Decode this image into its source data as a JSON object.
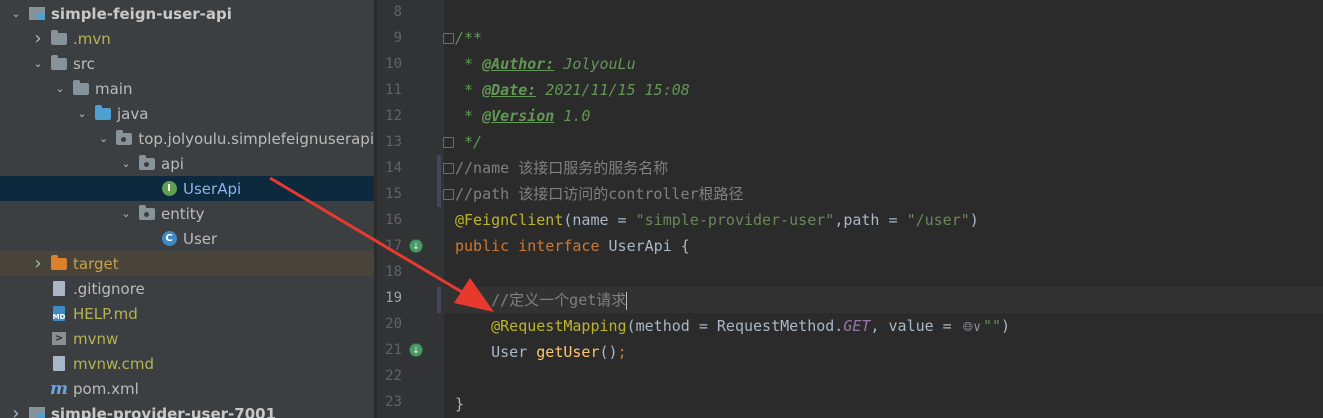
{
  "project_tree": [
    {
      "label": "simple-feign-user-api",
      "indent": 0,
      "arrow": "down",
      "icon": "module-icon",
      "style": "bold"
    },
    {
      "label": ".mvn",
      "indent": 1,
      "arrow": "right",
      "icon": "folder-icon",
      "style": "olive"
    },
    {
      "label": "src",
      "indent": 1,
      "arrow": "down",
      "icon": "folder-icon",
      "style": ""
    },
    {
      "label": "main",
      "indent": 2,
      "arrow": "down",
      "icon": "folder-icon",
      "style": ""
    },
    {
      "label": "java",
      "indent": 3,
      "arrow": "down",
      "icon": "source-folder-icon",
      "style": ""
    },
    {
      "label": "top.jolyoulu.simplefeignuserapi",
      "indent": 4,
      "arrow": "down",
      "icon": "package-icon",
      "style": ""
    },
    {
      "label": "api",
      "indent": 5,
      "arrow": "down",
      "icon": "package-icon",
      "style": ""
    },
    {
      "label": "UserApi",
      "indent": 6,
      "arrow": "",
      "icon": "interface-icon",
      "style": "link",
      "selected": true
    },
    {
      "label": "entity",
      "indent": 5,
      "arrow": "down",
      "icon": "package-icon",
      "style": ""
    },
    {
      "label": "User",
      "indent": 6,
      "arrow": "",
      "icon": "class-icon",
      "style": ""
    },
    {
      "label": "target",
      "indent": 1,
      "arrow": "right",
      "icon": "excluded-folder-icon",
      "style": "orange",
      "excluded": true
    },
    {
      "label": ".gitignore",
      "indent": 1,
      "arrow": "",
      "icon": "file-icon",
      "style": ""
    },
    {
      "label": "HELP.md",
      "indent": 1,
      "arrow": "",
      "icon": "markdown-icon",
      "style": "olive"
    },
    {
      "label": "mvnw",
      "indent": 1,
      "arrow": "",
      "icon": "terminal-icon",
      "style": "olive"
    },
    {
      "label": "mvnw.cmd",
      "indent": 1,
      "arrow": "",
      "icon": "file-icon",
      "style": "olive"
    },
    {
      "label": "pom.xml",
      "indent": 1,
      "arrow": "",
      "icon": "maven-icon",
      "style": ""
    },
    {
      "label": "simple-provider-user-7001",
      "indent": 0,
      "arrow": "right",
      "icon": "module-icon",
      "style": "bold"
    }
  ],
  "line_numbers": [
    "8",
    "9",
    "10",
    "11",
    "12",
    "13",
    "14",
    "15",
    "16",
    "17",
    "18",
    "19",
    "20",
    "21",
    "22",
    "23"
  ],
  "current_line": "19",
  "gutter_marks": [
    {
      "line": "9",
      "icon": "fold-icon"
    },
    {
      "line": "13",
      "icon": "fold-icon"
    },
    {
      "line": "14",
      "icon": "fold-icon"
    },
    {
      "line": "15",
      "icon": "fold-icon"
    },
    {
      "line": "17",
      "icon": "implemented-icon"
    },
    {
      "line": "21",
      "icon": "implemented-icon"
    }
  ],
  "code": {
    "l8": "",
    "l9": "/**",
    "l10_star": " * ",
    "l10_tag": "@Author:",
    "l10_val": " JolyouLu",
    "l11_star": " * ",
    "l11_tag": "@Date:",
    "l11_val": " 2021/11/15 15:08",
    "l12_star": " * ",
    "l12_tag": "@Version",
    "l12_val": " 1.0",
    "l13": " */",
    "l14": "//name 该接口服务的服务名称",
    "l15": "//path 该接口访问的controller根路径",
    "l16_ann": "@FeignClient",
    "l16_a": "(name = ",
    "l16_s1": "\"simple-provider-user\"",
    "l16_b": ",path = ",
    "l16_s2": "\"/user\"",
    "l16_c": ")",
    "l17_kw1": "public ",
    "l17_kw2": "interface ",
    "l17_rest": "UserApi {",
    "l19_indent": "    ",
    "l19_cmt": "//定义一个get请求",
    "l20_indent": "    ",
    "l20_ann": "@RequestMapping",
    "l20_a": "(method = RequestMethod.",
    "l20_const": "GET",
    "l20_b": ", value = ",
    "l20_s": "\"\"",
    "l20_c": ")",
    "l21_indent": "    ",
    "l21_type": "User ",
    "l21_fn": "getUser",
    "l21_rest": "()",
    "l21_semi": ";",
    "l23": "}"
  },
  "colors": {
    "arrow": "#e8392e",
    "background": "#2b2b2b",
    "sidebar": "#3c3f41"
  }
}
